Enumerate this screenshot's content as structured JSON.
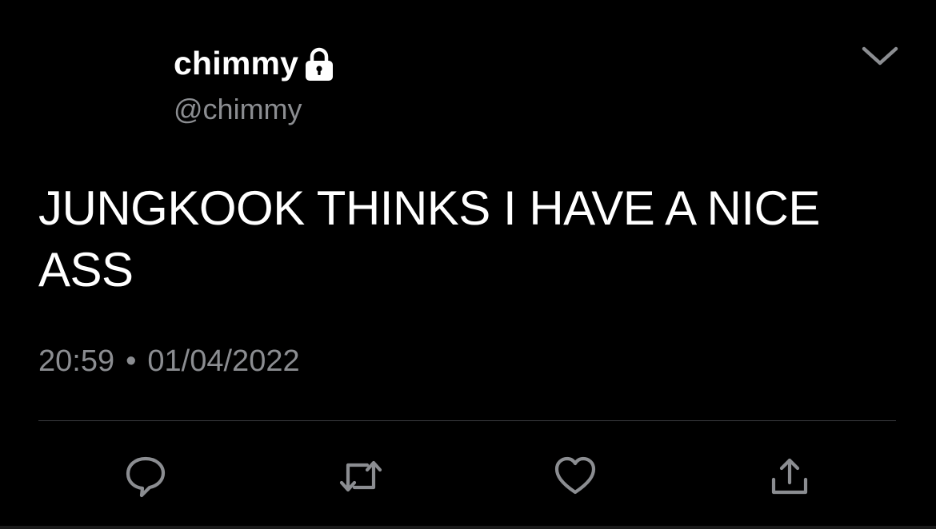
{
  "tweet": {
    "display_name": "chimmy",
    "handle": "@chimmy",
    "protected_icon": "lock-icon",
    "text": "JUNGKOOK THINKS I HAVE A NICE ASS",
    "time": "20:59",
    "separator": "•",
    "date": "01/04/2022"
  },
  "header": {
    "menu_icon": "chevron-down-icon"
  },
  "actions": {
    "reply_icon": "reply-icon",
    "retweet_icon": "retweet-icon",
    "like_icon": "heart-icon",
    "share_icon": "share-icon"
  },
  "colors": {
    "background": "#000000",
    "primary_text": "#ffffff",
    "secondary_text": "#8b8d91",
    "icon": "#8b8d91",
    "divider": "#3a3c40"
  }
}
